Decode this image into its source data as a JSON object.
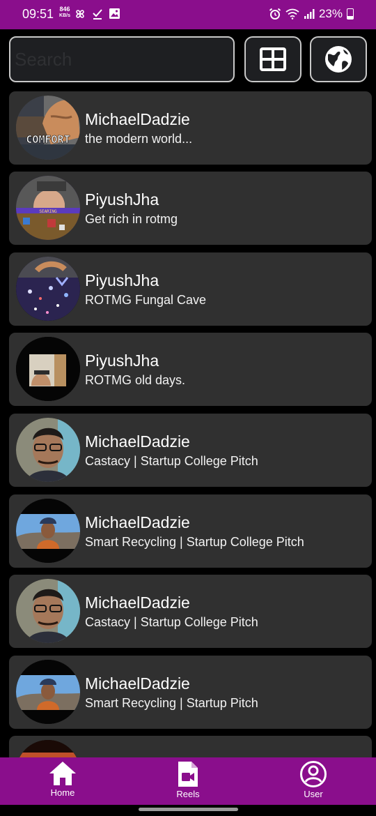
{
  "status_bar": {
    "time": "09:51",
    "kbs_value": "846",
    "kbs_unit": "KB/s",
    "battery": "23%"
  },
  "search": {
    "placeholder": "Search",
    "value": ""
  },
  "toolbar": {
    "grid_icon": "grid-view-icon",
    "globe_icon": "globe-icon"
  },
  "feed": {
    "items": [
      {
        "name": "MichaelDadzie",
        "title": "the modern world...",
        "thumb_text": "COMFORT"
      },
      {
        "name": "PiyushJha",
        "title": "Get rich in rotmg",
        "thumb_text": "SEARING"
      },
      {
        "name": "PiyushJha",
        "title": "ROTMG Fungal Cave"
      },
      {
        "name": "PiyushJha",
        "title": "ROTMG old days."
      },
      {
        "name": "MichaelDadzie",
        "title": "Castacy | Startup College Pitch"
      },
      {
        "name": "MichaelDadzie",
        "title": "Smart Recycling | Startup College Pitch"
      },
      {
        "name": "MichaelDadzie",
        "title": "Castacy | Startup College Pitch"
      },
      {
        "name": "MichaelDadzie",
        "title": "Smart Recycling | Startup Pitch"
      },
      {
        "name": "",
        "title": ""
      }
    ]
  },
  "bottom_nav": {
    "home_label": "Home",
    "reels_label": "Reels",
    "user_label": "User"
  },
  "colors": {
    "accent": "#8a0e8c",
    "card_bg": "#303030",
    "input_bg": "#1e1f22",
    "page_bg": "#000000"
  }
}
